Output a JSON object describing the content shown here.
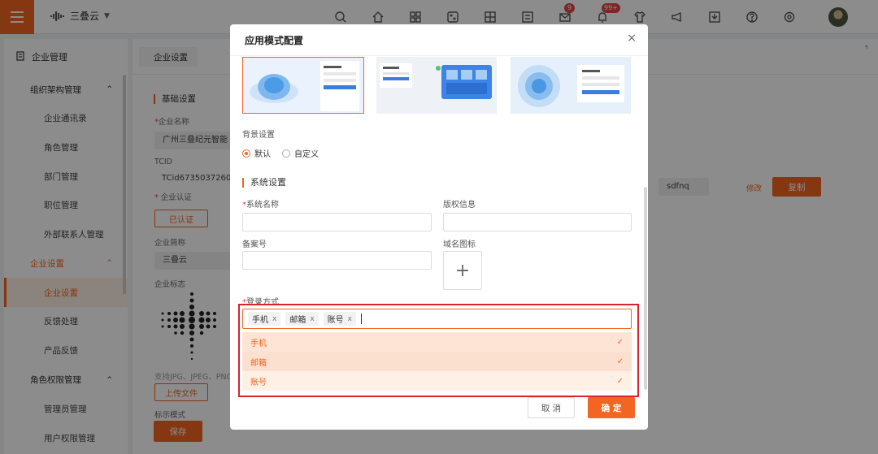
{
  "topbar": {
    "brand_name": "三叠云",
    "icons": [
      "search-icon",
      "home-icon",
      "apps-icon",
      "dice-icon",
      "grid-plus-icon",
      "form-icon",
      "mail-icon",
      "bell-icon",
      "shirt-icon",
      "megaphone-icon",
      "download-icon",
      "help-icon",
      "settings-icon"
    ],
    "mail_badge": "9",
    "bell_badge": "99+"
  },
  "sidebar": {
    "header": "企业管理",
    "groups": [
      {
        "label": "组织架构管理",
        "items": [
          "企业通讯录",
          "角色管理",
          "部门管理",
          "职位管理",
          "外部联系人管理"
        ]
      },
      {
        "label": "企业设置",
        "items": [
          "企业设置",
          "反馈处理",
          "产品反馈"
        ]
      },
      {
        "label": "角色权限管理",
        "items": [
          "管理员管理",
          "用户权限管理"
        ]
      }
    ]
  },
  "tabs": {
    "active": "企业设置"
  },
  "main": {
    "section_basic": "基础设置",
    "company_name_label": "企业名称",
    "company_name_value": "广州三叠纪元智能",
    "tcid_label": "TCID",
    "tcid_value": "TCid6735037260",
    "cert_label": "企业认证",
    "cert_button": "已认证",
    "short_name_label": "企业简称",
    "short_name_value": "三叠云",
    "logo_label": "企业标志",
    "upload_hint": "支持JPG、JPEG、PNG",
    "upload_button": "上传文件",
    "partial_label": "标示模式",
    "save_button": "保存",
    "sdfnq_value": "sdfnq",
    "modify_link": "修改",
    "copy_button": "复制"
  },
  "modal": {
    "title": "应用模式配置",
    "bg_label": "背景设置",
    "bg_options": [
      "默认",
      "自定义"
    ],
    "bg_selected": "默认",
    "section_system": "系统设置",
    "system_name_label": "系统名称",
    "copyright_label": "版权信息",
    "record_label": "备案号",
    "domain_icon_label": "域名图标",
    "login_label": "登录方式",
    "login_tags": [
      "手机",
      "邮箱",
      "账号"
    ],
    "dropdown_options": [
      "手机",
      "邮箱",
      "账号"
    ],
    "cancel_button": "取 消",
    "ok_button": "确 定"
  }
}
